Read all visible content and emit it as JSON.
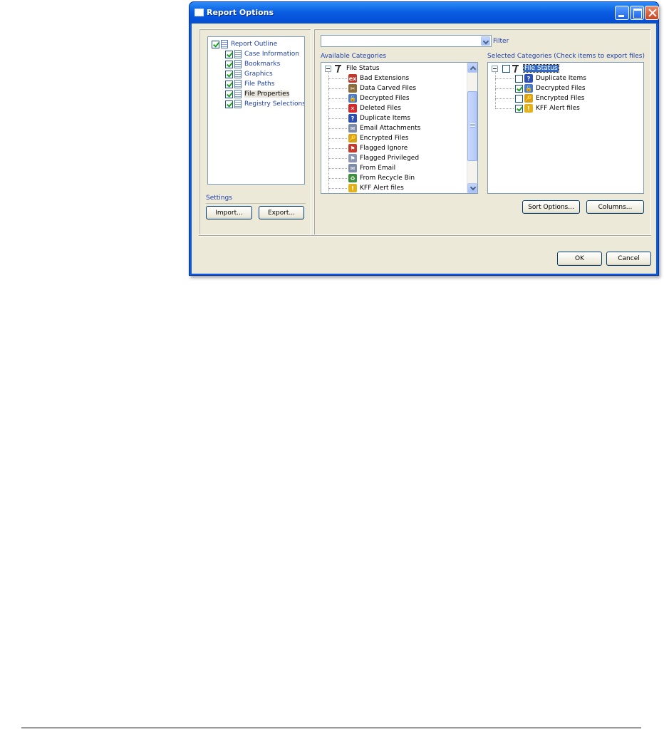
{
  "window": {
    "title": "Report Options"
  },
  "outline": {
    "items": [
      {
        "label": "Report Outline",
        "checked": true,
        "icon": "document-icon"
      },
      {
        "label": "Case Information",
        "checked": true,
        "icon": "document-icon"
      },
      {
        "label": "Bookmarks",
        "checked": true,
        "icon": "document-icon"
      },
      {
        "label": "Graphics",
        "checked": true,
        "icon": "document-icon"
      },
      {
        "label": "File Paths",
        "checked": true,
        "icon": "document-icon"
      },
      {
        "label": "File Properties",
        "checked": true,
        "icon": "document-icon",
        "selected": true
      },
      {
        "label": "Registry Selections",
        "checked": true,
        "icon": "document-icon"
      }
    ]
  },
  "settings": {
    "label": "Settings",
    "import_label": "Import...",
    "export_label": "Export..."
  },
  "filter": {
    "value": "",
    "label": "Filter"
  },
  "available": {
    "label": "Available Categories",
    "root": "File Status",
    "items": [
      {
        "label": "Bad Extensions",
        "icon": "bad-extension-icon",
        "color": "#c0392b",
        "glyph": "ex"
      },
      {
        "label": "Data Carved Files",
        "icon": "carved-file-icon",
        "color": "#8a6d3b",
        "glyph": "✂"
      },
      {
        "label": "Decrypted Files",
        "icon": "decrypted-file-icon",
        "color": "#4a79c9",
        "glyph": "🔓"
      },
      {
        "label": "Deleted Files",
        "icon": "deleted-file-icon",
        "color": "#d62828",
        "glyph": "✕"
      },
      {
        "label": "Duplicate Items",
        "icon": "duplicate-item-icon",
        "color": "#2d4fb3",
        "glyph": "?"
      },
      {
        "label": "Email Attachments",
        "icon": "email-attachment-icon",
        "color": "#7d8ca8",
        "glyph": "✉"
      },
      {
        "label": "Encrypted Files",
        "icon": "encrypted-file-icon",
        "color": "#d9a21b",
        "glyph": "🔑"
      },
      {
        "label": "Flagged Ignore",
        "icon": "flagged-ignore-icon",
        "color": "#c53a2a",
        "glyph": "⚑"
      },
      {
        "label": "Flagged Privileged",
        "icon": "flagged-privileged-icon",
        "color": "#8b97b5",
        "glyph": "⚑"
      },
      {
        "label": "From Email",
        "icon": "from-email-icon",
        "color": "#7d8ca8",
        "glyph": "✉"
      },
      {
        "label": "From Recycle Bin",
        "icon": "recycle-bin-icon",
        "color": "#3d8e3d",
        "glyph": "♻"
      },
      {
        "label": "KFF Alert files",
        "icon": "kff-alert-icon",
        "color": "#e3b21b",
        "glyph": "!"
      }
    ]
  },
  "selected": {
    "label": "Selected Categories (Check items to export files)",
    "root": "File Status",
    "root_checked": false,
    "items": [
      {
        "label": "Duplicate Items",
        "checked": false,
        "icon": "duplicate-item-icon",
        "color": "#2d4fb3",
        "glyph": "?"
      },
      {
        "label": "Decrypted Files",
        "checked": true,
        "icon": "decrypted-file-icon",
        "color": "#4a79c9",
        "glyph": "🔓"
      },
      {
        "label": "Encrypted Files",
        "checked": false,
        "icon": "encrypted-file-icon",
        "color": "#d9a21b",
        "glyph": "🔑"
      },
      {
        "label": "KFF Alert files",
        "checked": true,
        "icon": "kff-alert-icon",
        "color": "#e3b21b",
        "glyph": "!"
      }
    ]
  },
  "buttons": {
    "sort_options": "Sort Options...",
    "columns": "Columns...",
    "ok": "OK",
    "cancel": "Cancel"
  }
}
